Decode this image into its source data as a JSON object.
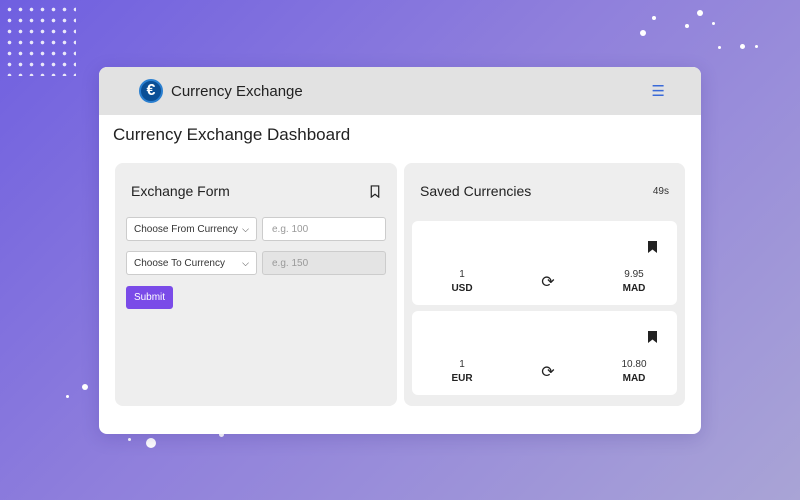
{
  "app": {
    "brand": "Currency Exchange",
    "logo_symbol": "€",
    "menu_icon": "hamburger-icon"
  },
  "page": {
    "title": "Currency Exchange Dashboard"
  },
  "exchange_form": {
    "title": "Exchange Form",
    "from_select": "Choose From Currency",
    "from_placeholder": "e.g. 100",
    "to_select": "Choose To Currency",
    "to_placeholder": "e.g. 150",
    "submit_label": "Submit"
  },
  "saved": {
    "title": "Saved Currencies",
    "timer": "49s",
    "items": [
      {
        "from_amount": "1",
        "from_code": "USD",
        "to_amount": "9.95",
        "to_code": "MAD"
      },
      {
        "from_amount": "1",
        "from_code": "EUR",
        "to_amount": "10.80",
        "to_code": "MAD"
      }
    ]
  },
  "colors": {
    "accent": "#7a4be8",
    "menu": "#3a6ad8",
    "logo": "#0a4f96"
  }
}
